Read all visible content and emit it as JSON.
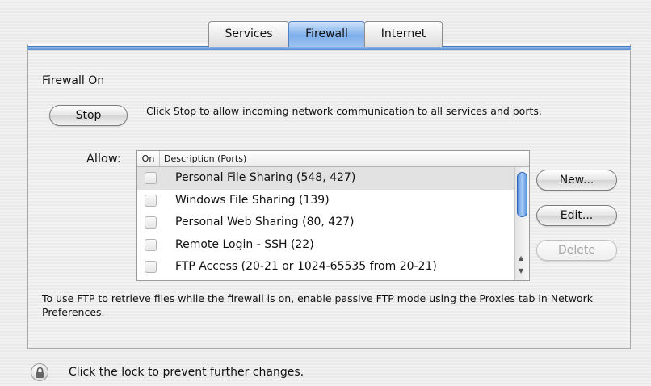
{
  "tabs": [
    {
      "label": "Services"
    },
    {
      "label": "Firewall"
    },
    {
      "label": "Internet"
    }
  ],
  "firewall": {
    "status_title": "Firewall On",
    "stop_label": "Stop",
    "stop_description": "Click Stop to allow incoming network communication to all services and ports.",
    "allow_label": "Allow:",
    "columns": {
      "on": "On",
      "description": "Description (Ports)"
    },
    "services": [
      {
        "name": "Personal File Sharing (548, 427)"
      },
      {
        "name": "Windows File Sharing (139)"
      },
      {
        "name": "Personal Web Sharing (80, 427)"
      },
      {
        "name": "Remote Login - SSH (22)"
      },
      {
        "name": "FTP Access (20-21 or 1024-65535 from 20-21)"
      }
    ],
    "buttons": {
      "new": "New...",
      "edit": "Edit...",
      "delete": "Delete"
    },
    "ftp_note": "To use FTP to retrieve files while the firewall is on, enable passive FTP mode using the Proxies tab in Network Preferences."
  },
  "footer": {
    "lock_icon": "lock-icon",
    "lock_text": "Click the lock to prevent further changes."
  },
  "colors": {
    "selected_tab": "#7eaeea",
    "scroll_thumb": "#5b93e0"
  }
}
